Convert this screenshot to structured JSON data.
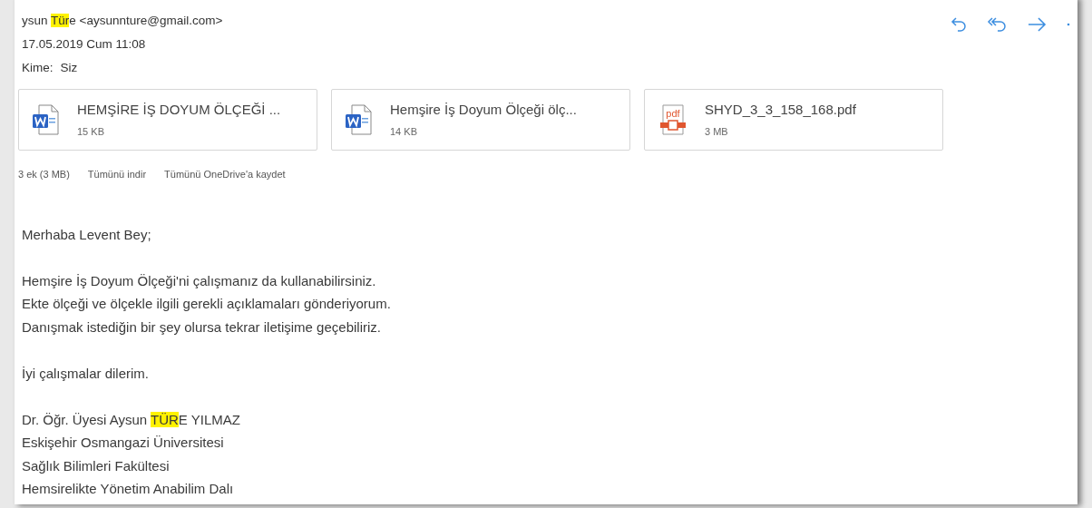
{
  "message": {
    "sender": {
      "before": "ysun ",
      "highlight": "Tür",
      "after": "e <aysunnture@gmail.com>"
    },
    "date": "17.05.2019 Cum 11:08",
    "to_label": "Kime:",
    "to": "Siz"
  },
  "attachments": [
    {
      "kind": "word",
      "name": "HEMŞİRE İŞ DOYUM ÖLÇEĞİ ...",
      "size": "15 KB"
    },
    {
      "kind": "word",
      "name": "Hemşire İş Doyum Ölçeği ölç...",
      "size": "14 KB"
    },
    {
      "kind": "pdf",
      "name": "SHYD_3_3_158_168.pdf",
      "size": "3 MB",
      "icon_text": "pdf"
    }
  ],
  "attachment_summary": "3 ek (3 MB)",
  "attachment_actions": [
    "Tümünü indir",
    "Tümünü OneDrive'a kaydet"
  ],
  "body": [
    {
      "kind": "line",
      "text": "Merhaba Levent Bey;"
    },
    {
      "kind": "blank"
    },
    {
      "kind": "line",
      "text": "Hemşire İş Doyum Ölçeği'ni çalışmanız da kullanabilirsiniz."
    },
    {
      "kind": "line",
      "text": "Ekte ölçeği ve ölçekle ilgili gerekli açıklamaları gönderiyorum."
    },
    {
      "kind": "line",
      "text": "Danışmak istediğin bir şey olursa tekrar iletişime geçebiliriz."
    },
    {
      "kind": "blank"
    },
    {
      "kind": "line",
      "text": "İyi çalışmalar dilerim."
    },
    {
      "kind": "blank"
    },
    {
      "kind": "highlighted",
      "before": "Dr. Öğr. Üyesi Aysun ",
      "highlight": "TÜR",
      "after": "E YILMAZ"
    },
    {
      "kind": "line",
      "text": "Eskişehir Osmangazi Üniversitesi"
    },
    {
      "kind": "line",
      "text": "Sağlık Bilimleri Fakültesi"
    },
    {
      "kind": "line",
      "text": "Hemsirelikte Yönetim Anabilim Dalı"
    }
  ]
}
